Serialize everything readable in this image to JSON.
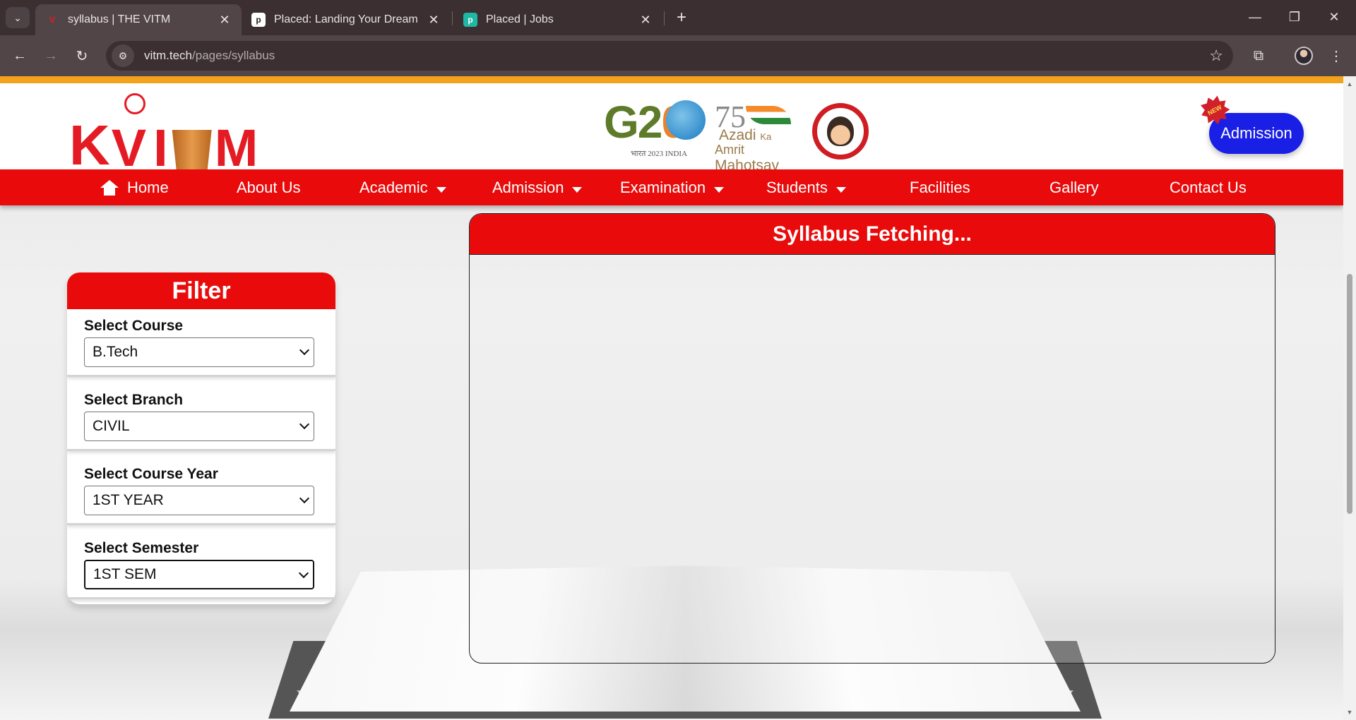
{
  "browser": {
    "tabs": [
      {
        "title": "syllabus | THE VITM",
        "active": true
      },
      {
        "title": "Placed: Landing Your Dream Tec",
        "active": false
      },
      {
        "title": "Placed | Jobs",
        "active": false
      }
    ],
    "url_host": "vitm.tech",
    "url_path": "/pages/syllabus",
    "icons": {
      "tab_list": "chevron-down-icon",
      "close": "close-icon",
      "new_tab": "plus-icon",
      "back": "arrow-left-icon",
      "forward": "arrow-right-icon",
      "reload": "reload-icon",
      "site_info": "tune-icon",
      "bookmark": "star-icon",
      "extensions": "puzzle-icon",
      "menu": "kebab-icon"
    }
  },
  "header": {
    "logo_text": "V I  M",
    "g20_text": "G20",
    "g20_sub": "भारत 2023 INDIA",
    "azadi_line1": "Azadi",
    "azadi_ka": "Ka",
    "azadi_amrit": "Amrit",
    "azadi_mahotsav": "Mahotsav",
    "azadi_75": "75",
    "new_badge": "NEW",
    "admission_button": "Admission"
  },
  "nav": {
    "items": [
      {
        "label": "Home",
        "dropdown": false
      },
      {
        "label": "About Us",
        "dropdown": false
      },
      {
        "label": "Academic",
        "dropdown": true
      },
      {
        "label": "Admission",
        "dropdown": true
      },
      {
        "label": "Examination",
        "dropdown": true
      },
      {
        "label": "Students",
        "dropdown": true
      },
      {
        "label": "Facilities",
        "dropdown": false
      },
      {
        "label": "Gallery",
        "dropdown": false
      },
      {
        "label": "Contact Us",
        "dropdown": false
      }
    ]
  },
  "filter": {
    "title": "Filter",
    "fields": [
      {
        "label": "Select Course",
        "value": "B.Tech"
      },
      {
        "label": "Select Branch",
        "value": "CIVIL"
      },
      {
        "label": "Select Course Year",
        "value": "1ST YEAR"
      },
      {
        "label": "Select Semester",
        "value": "1ST SEM"
      }
    ]
  },
  "syllabus": {
    "title": "Syllabus Fetching..."
  },
  "colors": {
    "brand_red": "#e90b0b",
    "admission_blue": "#1a1fe5",
    "accent_orange": "#f2a31b"
  }
}
